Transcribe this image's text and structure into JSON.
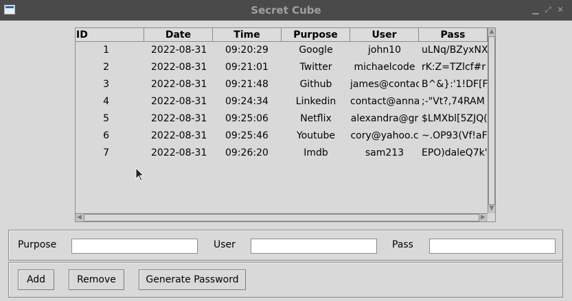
{
  "window": {
    "title": "Secret Cube"
  },
  "table": {
    "columns": [
      "ID",
      "Date",
      "Time",
      "Purpose",
      "User",
      "Pass"
    ],
    "rows": [
      [
        "1",
        "2022-08-31",
        "09:20:29",
        "Google",
        "john10",
        "uLNq/BZyxNX"
      ],
      [
        "2",
        "2022-08-31",
        "09:21:01",
        "Twitter",
        "michaelcode",
        "rK:Z=TZlcf#r"
      ],
      [
        "3",
        "2022-08-31",
        "09:21:48",
        "Github",
        "james@contac",
        "B^&}:'1!DF[F"
      ],
      [
        "4",
        "2022-08-31",
        "09:24:34",
        "Linkedin",
        "contact@anna",
        ";-\"Vt?,74RAM"
      ],
      [
        "5",
        "2022-08-31",
        "09:25:06",
        "Netflix",
        "alexandra@gr",
        "$LMXbl[5ZJQ("
      ],
      [
        "6",
        "2022-08-31",
        "09:25:46",
        "Youtube",
        "cory@yahoo.c",
        "~.OP93(Vf!aF"
      ],
      [
        "7",
        "2022-08-31",
        "09:26:20",
        "Imdb",
        "sam213",
        "EPO)daleQ7k'"
      ]
    ]
  },
  "form": {
    "purpose_label": "Purpose",
    "user_label": "User",
    "pass_label": "Pass",
    "purpose_value": "",
    "user_value": "",
    "pass_value": ""
  },
  "buttons": {
    "add": "Add",
    "remove": "Remove",
    "generate": "Generate Password"
  }
}
